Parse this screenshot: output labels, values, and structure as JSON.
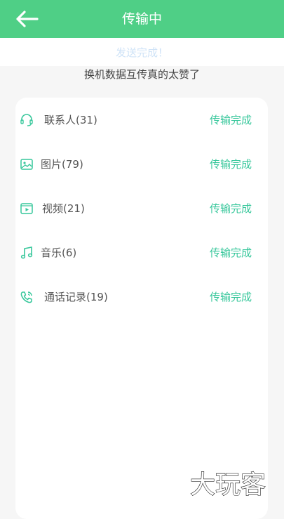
{
  "header": {
    "title": "传输中",
    "back_icon": "arrow-left-icon"
  },
  "status": {
    "text": "发送完成！"
  },
  "subtitle": "换机数据互传真的太赞了",
  "items": [
    {
      "icon": "headset-icon",
      "label": "联系人(31)",
      "state": "传输完成"
    },
    {
      "icon": "image-icon",
      "label": "图片(79)",
      "state": "传输完成"
    },
    {
      "icon": "video-icon",
      "label": "视频(21)",
      "state": "传输完成"
    },
    {
      "icon": "music-icon",
      "label": "音乐(6)",
      "state": "传输完成"
    },
    {
      "icon": "phone-call-icon",
      "label": "通话记录(19)",
      "state": "传输完成"
    }
  ],
  "watermark": {
    "text": "大玩客"
  },
  "colors": {
    "header": "#4fcf86",
    "accent": "#37c79b",
    "status": "#cfe3f7"
  }
}
